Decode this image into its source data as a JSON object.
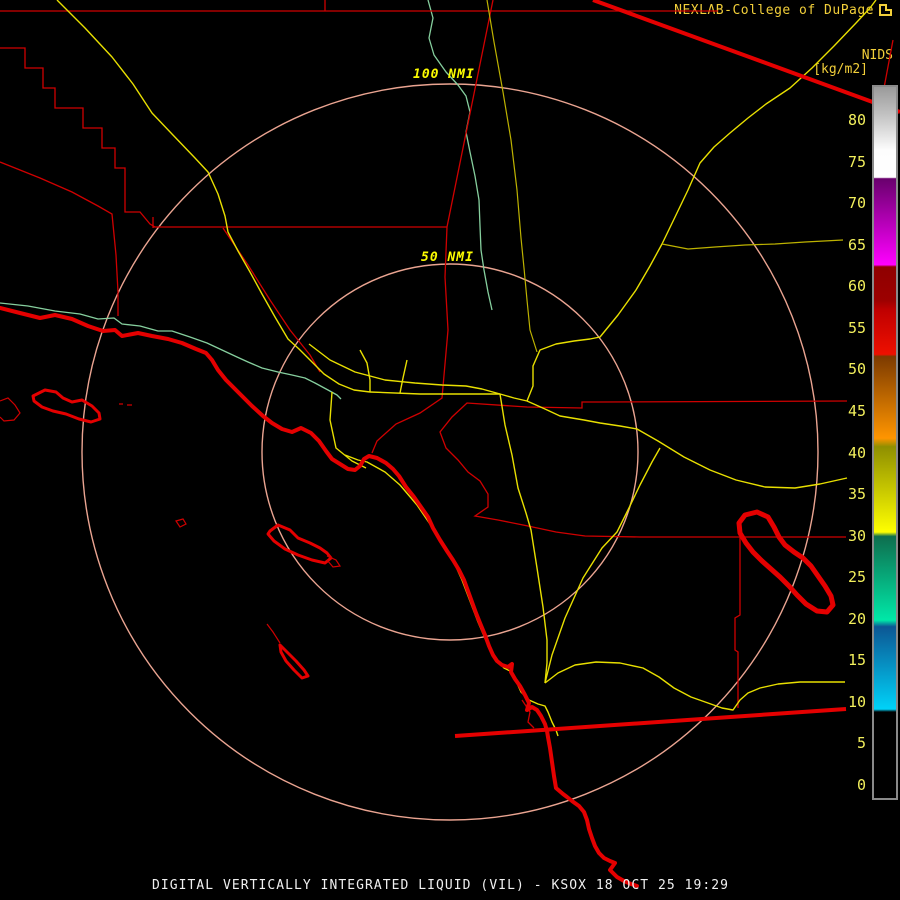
{
  "header": {
    "title": "NEXLAB-College of DuPage",
    "logo_icon": "cod-logo-icon",
    "nids_label": "NIDS",
    "units_label": "[kg/m2]"
  },
  "rings": {
    "outer_label": "100 NMI",
    "inner_label": "50 NMI"
  },
  "colorbar": {
    "tick_labels": [
      "80",
      "75",
      "70",
      "65",
      "60",
      "55",
      "50",
      "45",
      "40",
      "35",
      "30",
      "25",
      "20",
      "15",
      "10",
      "5",
      "0"
    ],
    "value_min": 0,
    "value_max": 80,
    "gradient_stops": [
      {
        "pos": 0.0,
        "color": "#9a9a9a"
      },
      {
        "pos": 3.9,
        "color": "#c2c2c2"
      },
      {
        "pos": 8.9,
        "color": "#fdfdfd"
      },
      {
        "pos": 12.7,
        "color": "#ffffff"
      },
      {
        "pos": 12.9,
        "color": "#69006d"
      },
      {
        "pos": 25.0,
        "color": "#ff00ff"
      },
      {
        "pos": 25.3,
        "color": "#8f0000"
      },
      {
        "pos": 30.0,
        "color": "#9c0000"
      },
      {
        "pos": 31.4,
        "color": "#c00000"
      },
      {
        "pos": 37.6,
        "color": "#ee1000"
      },
      {
        "pos": 37.9,
        "color": "#7c3a00"
      },
      {
        "pos": 49.4,
        "color": "#ff9500"
      },
      {
        "pos": 50.6,
        "color": "#8f8f00"
      },
      {
        "pos": 62.6,
        "color": "#ffff00"
      },
      {
        "pos": 63.2,
        "color": "#0e6e4e"
      },
      {
        "pos": 75.0,
        "color": "#00e8a8"
      },
      {
        "pos": 75.9,
        "color": "#0c5794"
      },
      {
        "pos": 87.5,
        "color": "#00d2f8"
      },
      {
        "pos": 87.9,
        "color": "#000000"
      },
      {
        "pos": 100.0,
        "color": "#000000"
      }
    ],
    "border_color": "#8a8a8a",
    "label_color": "#f2ef5c"
  },
  "map": {
    "colors": {
      "background": "#000000",
      "county_line": "#cf0000",
      "coastline": "#e40000",
      "road": "#e8df00",
      "road_dim": "#bdb200",
      "river": "#86cf9e",
      "range_ring": "#eaa491",
      "ring_label": "#fbfb00",
      "title": "#f2cf3a",
      "caption": "#f0f0f0"
    },
    "features": [
      "range-rings",
      "county-borders",
      "coastline",
      "islands",
      "salton-sea",
      "highways",
      "rivers",
      "state-line",
      "mexico-border"
    ]
  },
  "footer": {
    "caption": "DIGITAL VERTICALLY INTEGRATED LIQUID (VIL) - KSOX 18 OCT 25 19:29",
    "product": "Digital Vertically Integrated Liquid (VIL)",
    "station": "KSOX",
    "datetime": "18 OCT 25 19:29"
  }
}
